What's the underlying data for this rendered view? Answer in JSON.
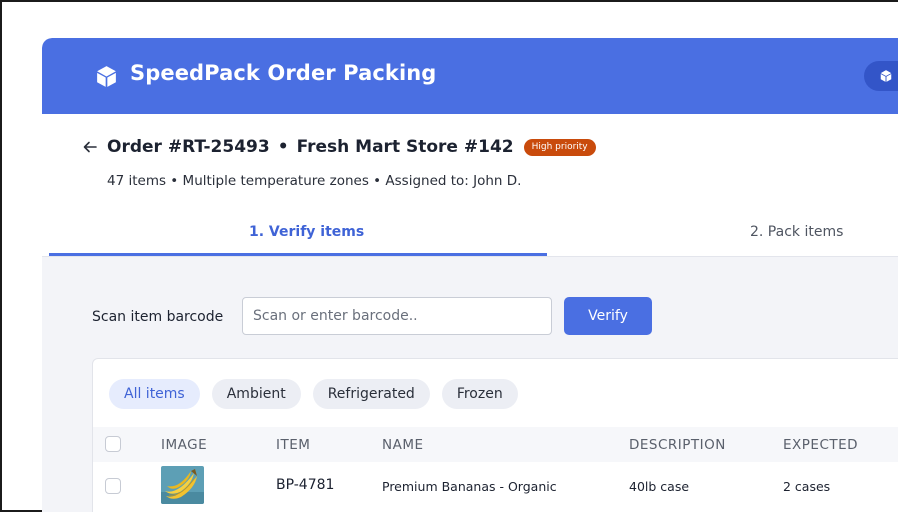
{
  "app": {
    "title": "SpeedPack Order Packing",
    "brand_icon": "package-cube-icon",
    "colors": {
      "primary": "#4a6fe2",
      "priority_badge": "#c94b0c"
    }
  },
  "order": {
    "back_icon": "arrow-left-icon",
    "number": "Order #RT-25493",
    "separator": "•",
    "store": "Fresh Mart Store #142",
    "priority_badge": "High priority",
    "summary": "47 items • Multiple temperature zones • Assigned to: John D."
  },
  "tabs": [
    {
      "label": "1. Verify items",
      "active": true
    },
    {
      "label": "2. Pack items",
      "active": false
    }
  ],
  "scan": {
    "label": "Scan item barcode",
    "placeholder": "Scan or enter barcode..",
    "value": "",
    "button_label": "Verify"
  },
  "filters": [
    {
      "label": "All items",
      "active": true
    },
    {
      "label": "Ambient",
      "active": false
    },
    {
      "label": "Refrigerated",
      "active": false
    },
    {
      "label": "Frozen",
      "active": false
    }
  ],
  "table": {
    "columns": [
      "IMAGE",
      "ITEM",
      "NAME",
      "DESCRIPTION",
      "EXPECTED"
    ],
    "rows": [
      {
        "image_icon": "bananas-image",
        "item": "BP-4781",
        "name": "Premium Bananas - Organic",
        "description": "40lb case",
        "expected": "2 cases"
      }
    ]
  }
}
